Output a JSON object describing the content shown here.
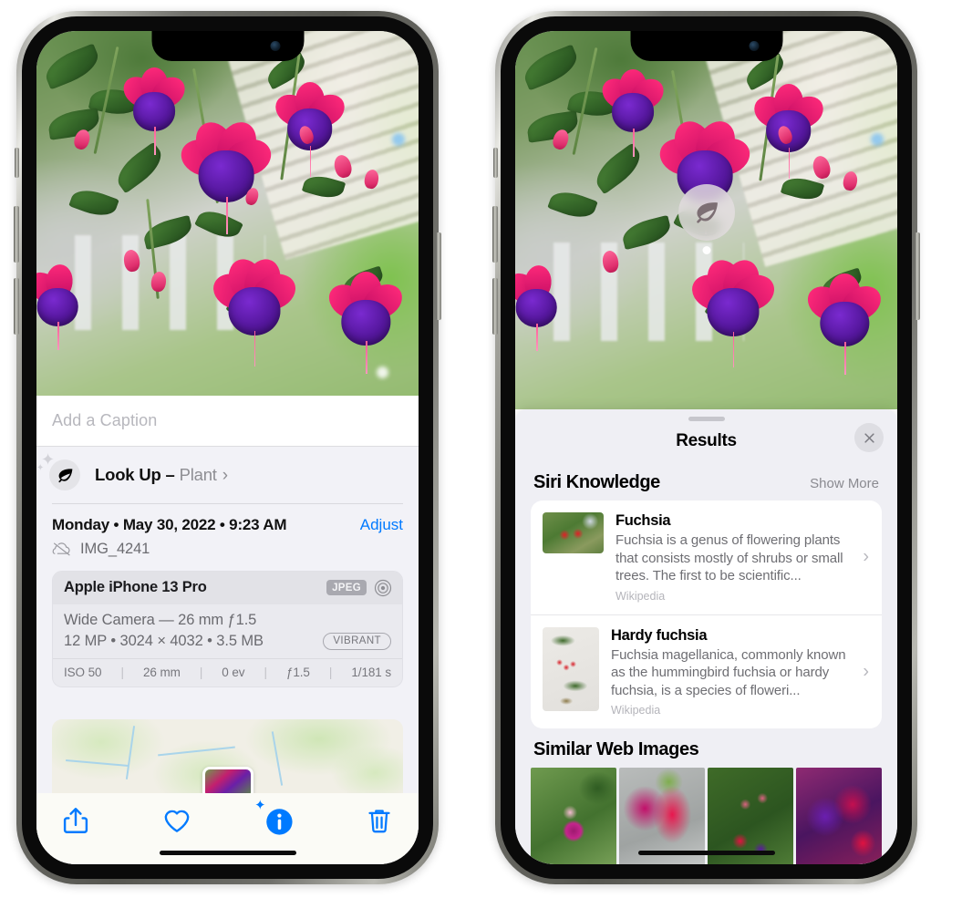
{
  "left_phone": {
    "caption_placeholder": "Add a Caption",
    "lookup": {
      "icon": "leaf-icon",
      "label": "Look Up",
      "dash": " – ",
      "kind": "Plant",
      "chevron": "›"
    },
    "metadata": {
      "date": "Monday • May 30, 2022 • 9:23 AM",
      "adjust_label": "Adjust",
      "cloud_icon": "cloud-slash-icon",
      "filename": "IMG_4241"
    },
    "exif": {
      "device": "Apple iPhone 13 Pro",
      "format_badge": "JPEG",
      "lens_icon": "camera-target-icon",
      "lens_line": "Wide Camera — 26 mm ƒ1.5",
      "size_line": "12 MP • 3024 × 4032 • 3.5 MB",
      "style_badge": "VIBRANT",
      "settings": [
        "ISO 50",
        "26 mm",
        "0 ev",
        "ƒ1.5",
        "1/181 s"
      ],
      "separator": "|"
    },
    "toolbar": {
      "share_label": "share-icon",
      "favorite_label": "heart-icon",
      "info_label": "info-sparkle-icon",
      "delete_label": "trash-icon"
    }
  },
  "right_phone": {
    "photo_badge": {
      "icon": "leaf-icon"
    },
    "sheet": {
      "title": "Results",
      "close_icon": "close-icon"
    },
    "siri_knowledge": {
      "title": "Siri Knowledge",
      "show_more": "Show More",
      "items": [
        {
          "name": "Fuchsia",
          "description": "Fuchsia is a genus of flowering plants that consists mostly of shrubs or small trees. The first to be scientific...",
          "source": "Wikipedia",
          "chevron": "›"
        },
        {
          "name": "Hardy fuchsia",
          "description": "Fuchsia magellanica, commonly known as the hummingbird fuchsia or hardy fuchsia, is a species of floweri...",
          "source": "Wikipedia",
          "chevron": "›"
        }
      ]
    },
    "similar_web_images": {
      "title": "Similar Web Images",
      "count": 4
    }
  },
  "colors": {
    "accent_blue": "#007AFF",
    "sheet_bg": "#EFEFF4",
    "detail_bg": "#F2F2F7",
    "card_white": "#FFFFFF",
    "secondary_text": "#8E8E93"
  }
}
